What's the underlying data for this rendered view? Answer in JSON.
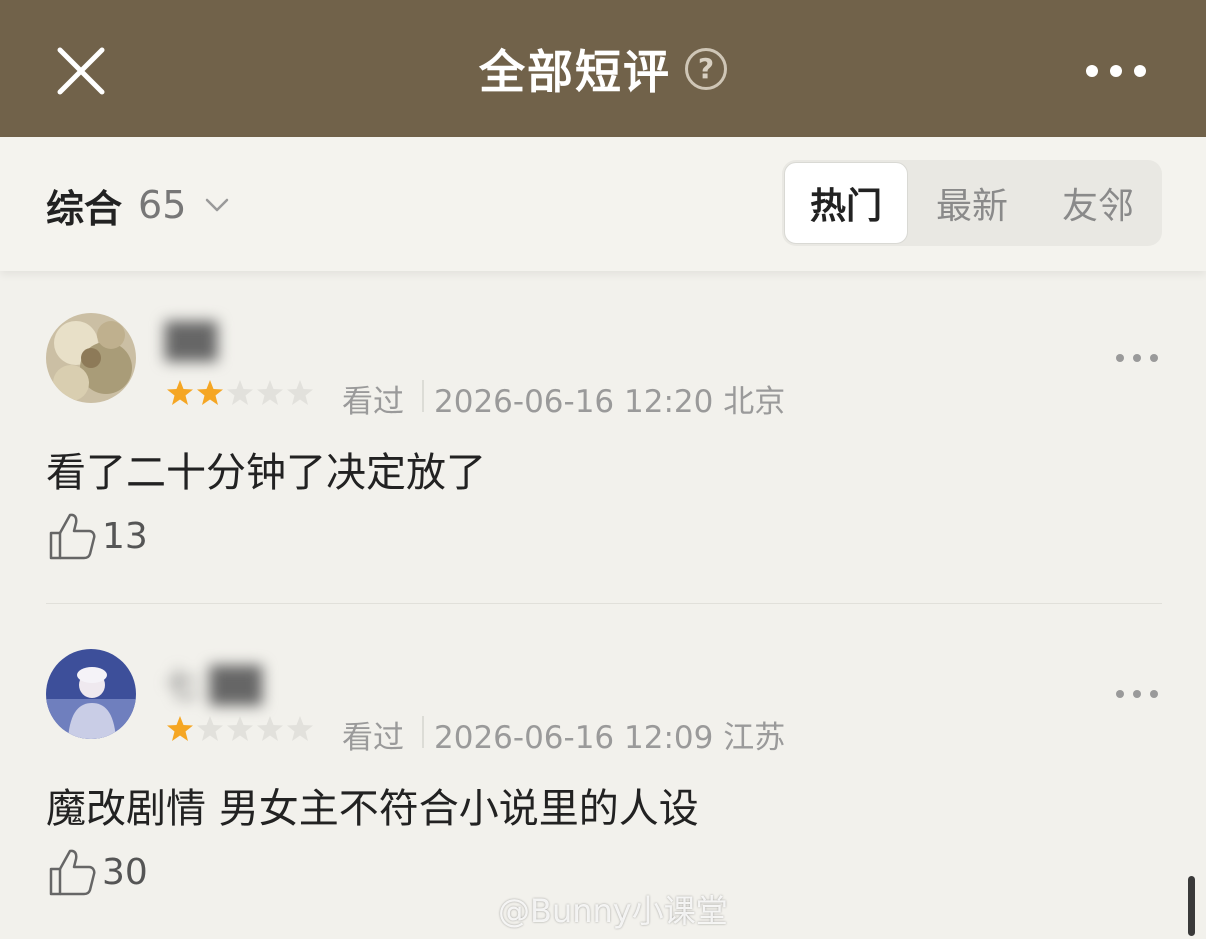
{
  "header": {
    "title": "全部短评",
    "help": "?"
  },
  "filter": {
    "sort_label": "综合",
    "count": "65",
    "tabs": [
      {
        "label": "热门",
        "active": true
      },
      {
        "label": "最新",
        "active": false
      },
      {
        "label": "友邻",
        "active": false
      }
    ]
  },
  "reviews": [
    {
      "username": "██",
      "rating": 2,
      "rating_max": 5,
      "status": "看过",
      "datetime": "2026-06-16 12:20",
      "location": "北京",
      "text": "看了二十分钟了决定放了",
      "likes": "13"
    },
    {
      "username": "七 ██",
      "rating": 1,
      "rating_max": 5,
      "status": "看过",
      "datetime": "2026-06-16 12:09",
      "location": "江苏",
      "text": "魔改剧情 男女主不符合小说里的人设",
      "likes": "30"
    }
  ],
  "watermark": "@Bunny小课堂",
  "colors": {
    "header_bg": "#71624a",
    "star_on": "#f5a623",
    "star_off": "#e2e1dc"
  }
}
